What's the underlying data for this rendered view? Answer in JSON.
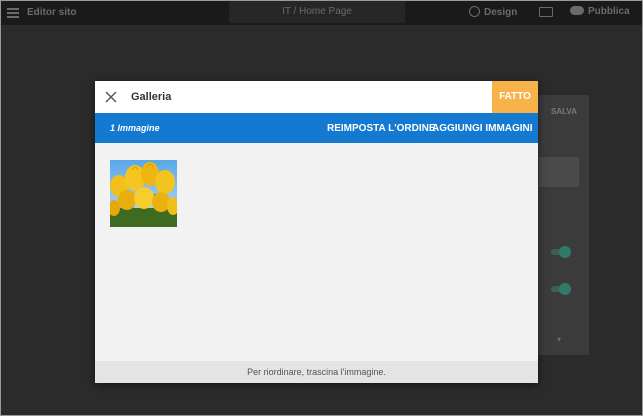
{
  "topbar": {
    "site_title": "Editor sito",
    "page_selector": "IT / Home Page",
    "design_label": "Design",
    "publish_label": "Pubblica"
  },
  "background_panel": {
    "save_label": "SALVA"
  },
  "gallery_modal": {
    "title": "Galleria",
    "done_label": "FATTO",
    "image_count": "1 Immagine",
    "reset_order_label": "REIMPOSTA L'ORDINE",
    "add_images_label": "AGGIUNGI IMMAGINI",
    "images": [
      {
        "alt": "tulips"
      }
    ],
    "footer_hint": "Per riordinare, trascina l'immagine."
  },
  "colors": {
    "toolbar_blue": "#1479d1",
    "done_orange": "#f7b24a",
    "overlay": "#2b2b2b"
  }
}
